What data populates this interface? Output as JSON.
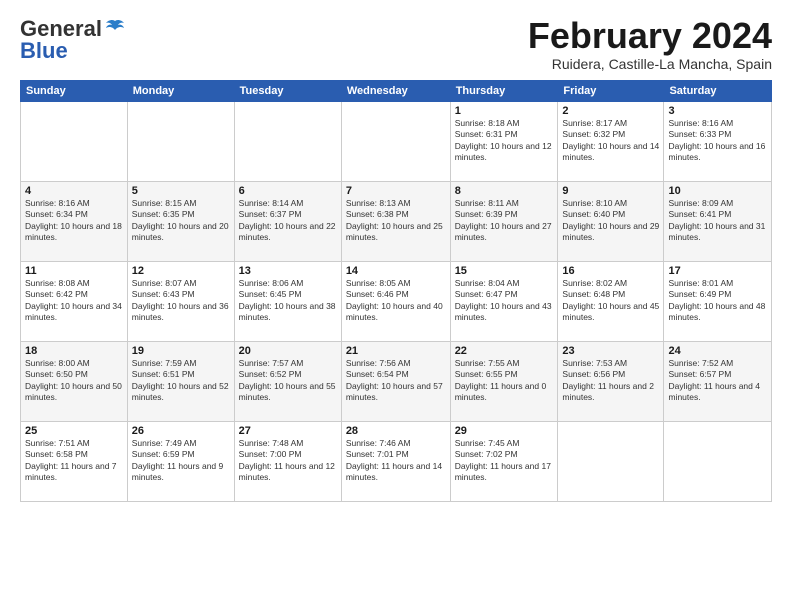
{
  "logo": {
    "general": "General",
    "blue": "Blue"
  },
  "header": {
    "month": "February 2024",
    "location": "Ruidera, Castille-La Mancha, Spain"
  },
  "weekdays": [
    "Sunday",
    "Monday",
    "Tuesday",
    "Wednesday",
    "Thursday",
    "Friday",
    "Saturday"
  ],
  "weeks": [
    [
      {
        "day": "",
        "sunrise": "",
        "sunset": "",
        "daylight": ""
      },
      {
        "day": "",
        "sunrise": "",
        "sunset": "",
        "daylight": ""
      },
      {
        "day": "",
        "sunrise": "",
        "sunset": "",
        "daylight": ""
      },
      {
        "day": "",
        "sunrise": "",
        "sunset": "",
        "daylight": ""
      },
      {
        "day": "1",
        "sunrise": "Sunrise: 8:18 AM",
        "sunset": "Sunset: 6:31 PM",
        "daylight": "Daylight: 10 hours and 12 minutes."
      },
      {
        "day": "2",
        "sunrise": "Sunrise: 8:17 AM",
        "sunset": "Sunset: 6:32 PM",
        "daylight": "Daylight: 10 hours and 14 minutes."
      },
      {
        "day": "3",
        "sunrise": "Sunrise: 8:16 AM",
        "sunset": "Sunset: 6:33 PM",
        "daylight": "Daylight: 10 hours and 16 minutes."
      }
    ],
    [
      {
        "day": "4",
        "sunrise": "Sunrise: 8:16 AM",
        "sunset": "Sunset: 6:34 PM",
        "daylight": "Daylight: 10 hours and 18 minutes."
      },
      {
        "day": "5",
        "sunrise": "Sunrise: 8:15 AM",
        "sunset": "Sunset: 6:35 PM",
        "daylight": "Daylight: 10 hours and 20 minutes."
      },
      {
        "day": "6",
        "sunrise": "Sunrise: 8:14 AM",
        "sunset": "Sunset: 6:37 PM",
        "daylight": "Daylight: 10 hours and 22 minutes."
      },
      {
        "day": "7",
        "sunrise": "Sunrise: 8:13 AM",
        "sunset": "Sunset: 6:38 PM",
        "daylight": "Daylight: 10 hours and 25 minutes."
      },
      {
        "day": "8",
        "sunrise": "Sunrise: 8:11 AM",
        "sunset": "Sunset: 6:39 PM",
        "daylight": "Daylight: 10 hours and 27 minutes."
      },
      {
        "day": "9",
        "sunrise": "Sunrise: 8:10 AM",
        "sunset": "Sunset: 6:40 PM",
        "daylight": "Daylight: 10 hours and 29 minutes."
      },
      {
        "day": "10",
        "sunrise": "Sunrise: 8:09 AM",
        "sunset": "Sunset: 6:41 PM",
        "daylight": "Daylight: 10 hours and 31 minutes."
      }
    ],
    [
      {
        "day": "11",
        "sunrise": "Sunrise: 8:08 AM",
        "sunset": "Sunset: 6:42 PM",
        "daylight": "Daylight: 10 hours and 34 minutes."
      },
      {
        "day": "12",
        "sunrise": "Sunrise: 8:07 AM",
        "sunset": "Sunset: 6:43 PM",
        "daylight": "Daylight: 10 hours and 36 minutes."
      },
      {
        "day": "13",
        "sunrise": "Sunrise: 8:06 AM",
        "sunset": "Sunset: 6:45 PM",
        "daylight": "Daylight: 10 hours and 38 minutes."
      },
      {
        "day": "14",
        "sunrise": "Sunrise: 8:05 AM",
        "sunset": "Sunset: 6:46 PM",
        "daylight": "Daylight: 10 hours and 40 minutes."
      },
      {
        "day": "15",
        "sunrise": "Sunrise: 8:04 AM",
        "sunset": "Sunset: 6:47 PM",
        "daylight": "Daylight: 10 hours and 43 minutes."
      },
      {
        "day": "16",
        "sunrise": "Sunrise: 8:02 AM",
        "sunset": "Sunset: 6:48 PM",
        "daylight": "Daylight: 10 hours and 45 minutes."
      },
      {
        "day": "17",
        "sunrise": "Sunrise: 8:01 AM",
        "sunset": "Sunset: 6:49 PM",
        "daylight": "Daylight: 10 hours and 48 minutes."
      }
    ],
    [
      {
        "day": "18",
        "sunrise": "Sunrise: 8:00 AM",
        "sunset": "Sunset: 6:50 PM",
        "daylight": "Daylight: 10 hours and 50 minutes."
      },
      {
        "day": "19",
        "sunrise": "Sunrise: 7:59 AM",
        "sunset": "Sunset: 6:51 PM",
        "daylight": "Daylight: 10 hours and 52 minutes."
      },
      {
        "day": "20",
        "sunrise": "Sunrise: 7:57 AM",
        "sunset": "Sunset: 6:52 PM",
        "daylight": "Daylight: 10 hours and 55 minutes."
      },
      {
        "day": "21",
        "sunrise": "Sunrise: 7:56 AM",
        "sunset": "Sunset: 6:54 PM",
        "daylight": "Daylight: 10 hours and 57 minutes."
      },
      {
        "day": "22",
        "sunrise": "Sunrise: 7:55 AM",
        "sunset": "Sunset: 6:55 PM",
        "daylight": "Daylight: 11 hours and 0 minutes."
      },
      {
        "day": "23",
        "sunrise": "Sunrise: 7:53 AM",
        "sunset": "Sunset: 6:56 PM",
        "daylight": "Daylight: 11 hours and 2 minutes."
      },
      {
        "day": "24",
        "sunrise": "Sunrise: 7:52 AM",
        "sunset": "Sunset: 6:57 PM",
        "daylight": "Daylight: 11 hours and 4 minutes."
      }
    ],
    [
      {
        "day": "25",
        "sunrise": "Sunrise: 7:51 AM",
        "sunset": "Sunset: 6:58 PM",
        "daylight": "Daylight: 11 hours and 7 minutes."
      },
      {
        "day": "26",
        "sunrise": "Sunrise: 7:49 AM",
        "sunset": "Sunset: 6:59 PM",
        "daylight": "Daylight: 11 hours and 9 minutes."
      },
      {
        "day": "27",
        "sunrise": "Sunrise: 7:48 AM",
        "sunset": "Sunset: 7:00 PM",
        "daylight": "Daylight: 11 hours and 12 minutes."
      },
      {
        "day": "28",
        "sunrise": "Sunrise: 7:46 AM",
        "sunset": "Sunset: 7:01 PM",
        "daylight": "Daylight: 11 hours and 14 minutes."
      },
      {
        "day": "29",
        "sunrise": "Sunrise: 7:45 AM",
        "sunset": "Sunset: 7:02 PM",
        "daylight": "Daylight: 11 hours and 17 minutes."
      },
      {
        "day": "",
        "sunrise": "",
        "sunset": "",
        "daylight": ""
      },
      {
        "day": "",
        "sunrise": "",
        "sunset": "",
        "daylight": ""
      }
    ]
  ]
}
